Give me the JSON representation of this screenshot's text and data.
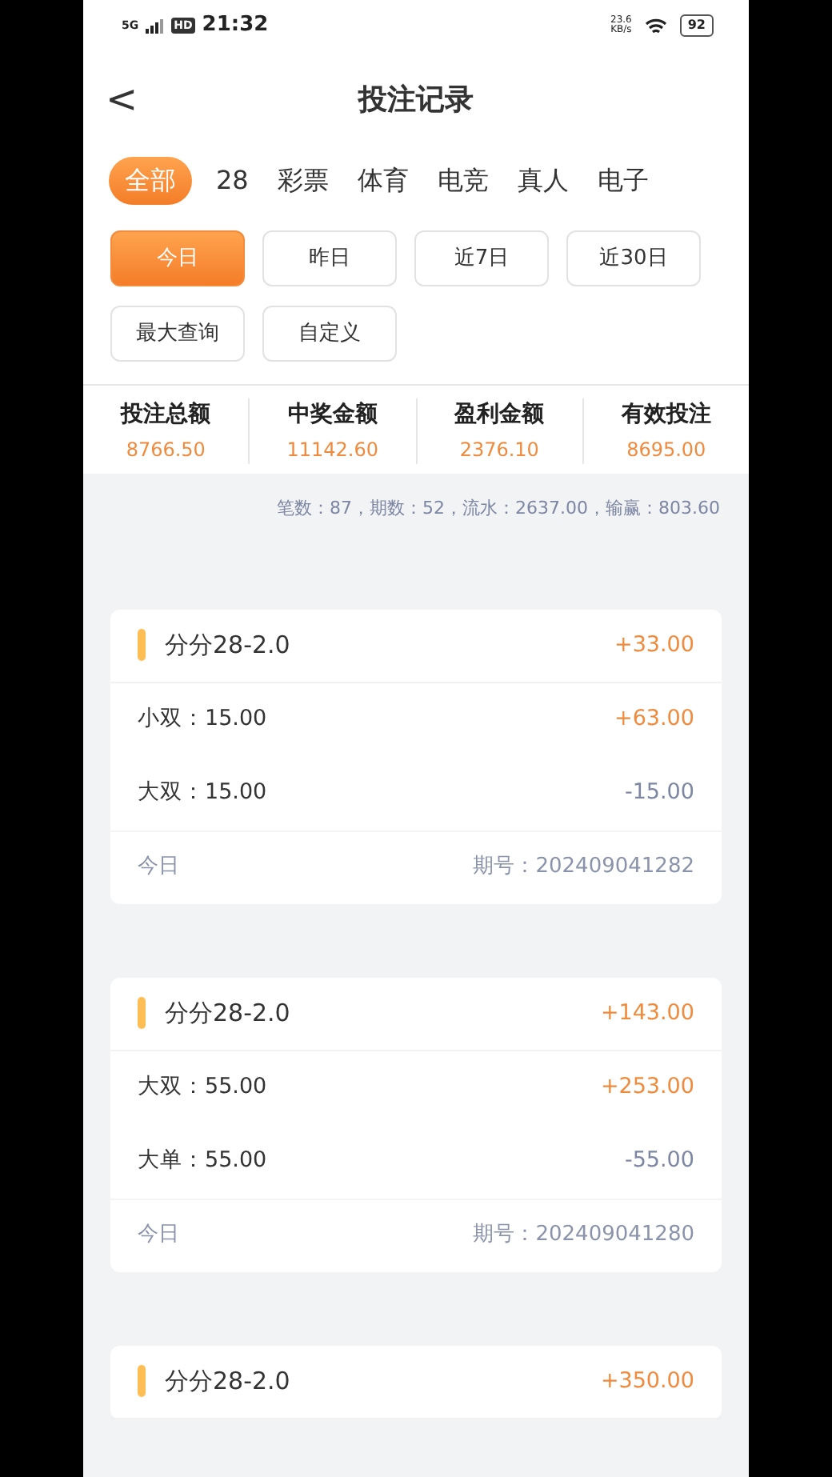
{
  "status_bar": {
    "network": "5G",
    "hd": "HD",
    "time": "21:32",
    "speed_value": "23.6",
    "speed_unit": "KB/s",
    "battery": "92"
  },
  "header": {
    "back": "<",
    "title": "投注记录"
  },
  "tabs": [
    {
      "label": "全部",
      "selected": true
    },
    {
      "label": "28",
      "selected": false
    },
    {
      "label": "彩票",
      "selected": false
    },
    {
      "label": "体育",
      "selected": false
    },
    {
      "label": "电竞",
      "selected": false
    },
    {
      "label": "真人",
      "selected": false
    },
    {
      "label": "电子",
      "selected": false
    }
  ],
  "filters": [
    {
      "label": "今日",
      "selected": true
    },
    {
      "label": "昨日",
      "selected": false
    },
    {
      "label": "近7日",
      "selected": false
    },
    {
      "label": "近30日",
      "selected": false
    },
    {
      "label": "最大查询",
      "selected": false
    },
    {
      "label": "自定义",
      "selected": false
    }
  ],
  "stats": [
    {
      "label": "投注总额",
      "value": "8766.50"
    },
    {
      "label": "中奖金额",
      "value": "11142.60"
    },
    {
      "label": "盈利金额",
      "value": "2376.10"
    },
    {
      "label": "有效投注",
      "value": "8695.00"
    }
  ],
  "summary": "笔数：87，期数：52，流水：2637.00，输赢：803.60",
  "records": [
    {
      "game": "分分28-2.0",
      "total": "+33.00",
      "total_positive": true,
      "bets": [
        {
          "bet": "小双：15.00",
          "result": "+63.00",
          "positive": true
        },
        {
          "bet": "大双：15.00",
          "result": "-15.00",
          "positive": false
        }
      ],
      "date": "今日",
      "period": "期号：202409041282"
    },
    {
      "game": "分分28-2.0",
      "total": "+143.00",
      "total_positive": true,
      "bets": [
        {
          "bet": "大双：55.00",
          "result": "+253.00",
          "positive": true
        },
        {
          "bet": "大单：55.00",
          "result": "-55.00",
          "positive": false
        }
      ],
      "date": "今日",
      "period": "期号：202409041280"
    },
    {
      "game": "分分28-2.0",
      "total": "+350.00",
      "total_positive": true
    }
  ]
}
